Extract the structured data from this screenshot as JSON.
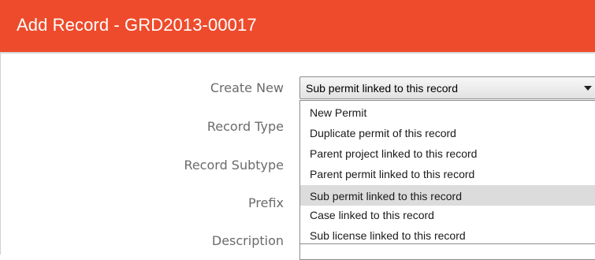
{
  "dialog": {
    "title": "Add Record - GRD2013-00017"
  },
  "form": {
    "labels": {
      "create_new": "Create New",
      "record_type": "Record Type",
      "record_subtype": "Record Subtype",
      "prefix": "Prefix",
      "description": "Description"
    },
    "create_new_select": {
      "selected_value": "Sub permit linked to this record",
      "options": [
        "New Permit",
        "Duplicate permit of this record",
        "Parent project linked to this record",
        "Parent permit linked to this record",
        "Sub permit linked to this record",
        "Case linked to this record",
        "Sub license linked to this record"
      ],
      "highlighted_option": "Sub permit linked to this record"
    }
  },
  "colors": {
    "title_bar": "#ee4b2c",
    "title_text": "#ffffff",
    "label_text": "#6b6b6b",
    "highlight": "#dcdcdc"
  }
}
